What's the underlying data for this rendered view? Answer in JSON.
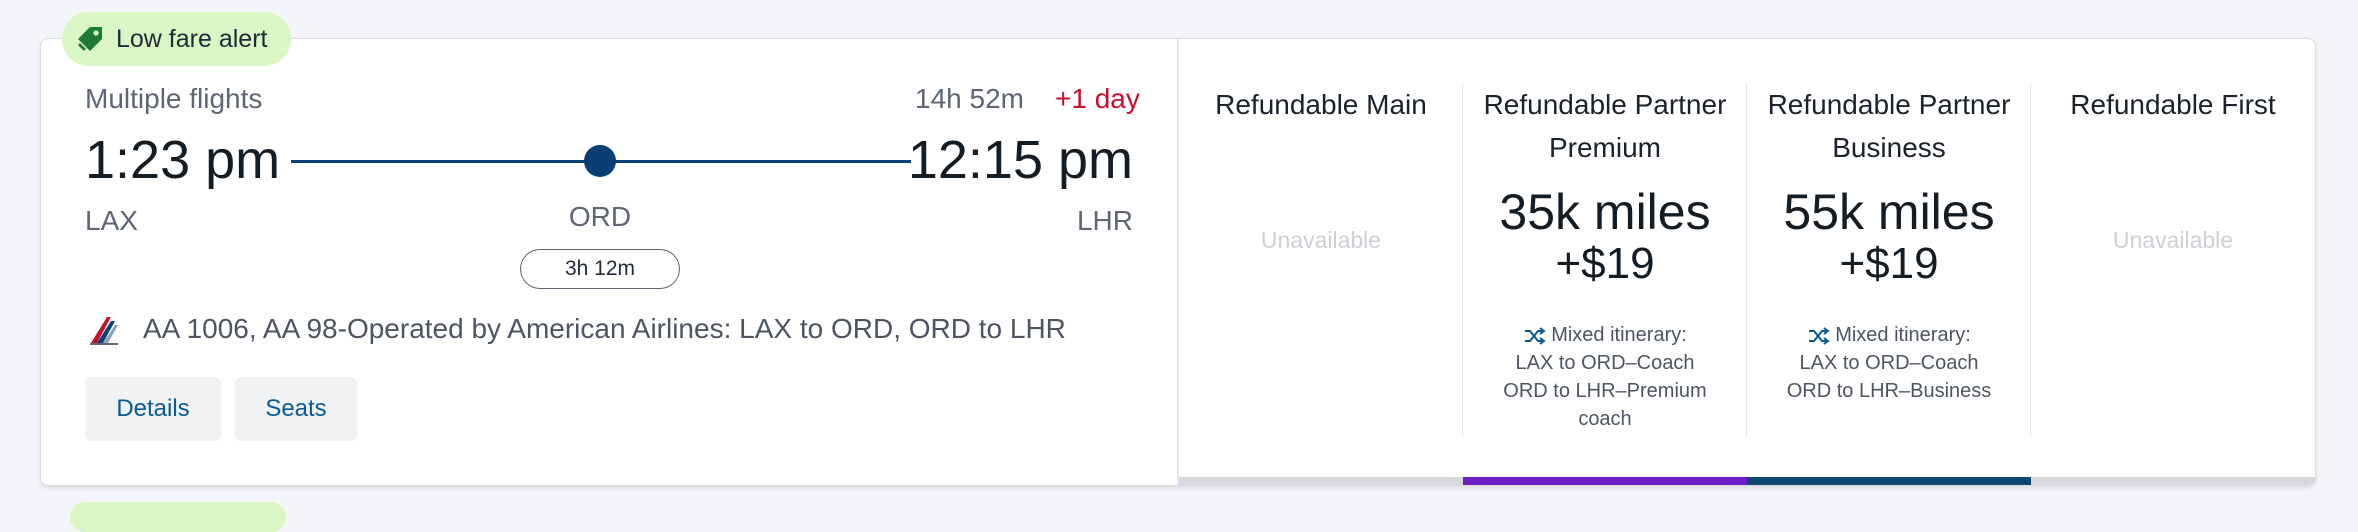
{
  "badge": {
    "label": "Low fare alert",
    "icon": "price-tag-icon",
    "bg": "#d9f6c4"
  },
  "flight": {
    "type": "Multiple flights",
    "duration": "14h 52m",
    "day_offset": "+1 day",
    "depart_time": "1:23 pm",
    "arrive_time": "12:15 pm",
    "depart_code": "LAX",
    "stop_code": "ORD",
    "arrive_code": "LHR",
    "layover": "3h 12m",
    "description": "AA 1006, AA 98-Operated by American Airlines: LAX to ORD, ORD to LHR",
    "airline_icon": "american-airlines-logo-icon"
  },
  "actions": {
    "details": "Details",
    "seats": "Seats"
  },
  "fares": [
    {
      "title": "Refundable Main",
      "unavailable": "Unavailable",
      "bar_color": "#d6d8dc"
    },
    {
      "title": "Refundable Partner Premium",
      "miles": "35k miles",
      "fee": "+$19",
      "mixed_label": "Mixed itinerary:",
      "leg1": "LAX to ORD–Coach",
      "leg2": "ORD to LHR–Premium coach",
      "bar_color": "#6c1fc4"
    },
    {
      "title": "Refundable Partner Business",
      "miles": "55k miles",
      "fee": "+$19",
      "mixed_label": "Mixed itinerary:",
      "leg1": "LAX to ORD–Coach",
      "leg2": "ORD to LHR–Business",
      "bar_color": "#0d4771"
    },
    {
      "title": "Refundable First",
      "unavailable": "Unavailable",
      "bar_color": "#d6d8dc"
    }
  ],
  "colors": {
    "accent": "#0b3f73",
    "alert_red": "#c8102e",
    "link": "#0a5a94"
  }
}
